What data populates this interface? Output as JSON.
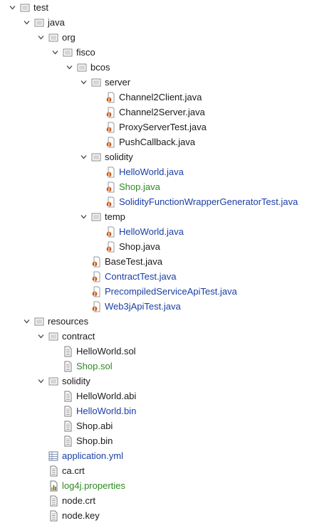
{
  "colors": {
    "default_text": "#1a1a1a",
    "modified_text": "#1a3ea5",
    "added_text": "#2c8a22",
    "folder_icon": "#8a8a8a",
    "java_icon": "#c85a1c"
  },
  "tree": {
    "test": {
      "label": "test",
      "expanded": true,
      "icon": "folder-icon"
    },
    "java": {
      "label": "java",
      "expanded": true,
      "icon": "folder-icon"
    },
    "org": {
      "label": "org",
      "expanded": true,
      "icon": "folder-icon"
    },
    "fisco": {
      "label": "fisco",
      "expanded": true,
      "icon": "folder-icon"
    },
    "bcos": {
      "label": "bcos",
      "expanded": true,
      "icon": "folder-icon"
    },
    "server": {
      "label": "server",
      "expanded": true,
      "icon": "folder-icon"
    },
    "server_files": [
      {
        "label": "Channel2Client.java",
        "status": "default",
        "icon": "java-file-icon"
      },
      {
        "label": "Channel2Server.java",
        "status": "default",
        "icon": "java-file-icon"
      },
      {
        "label": "ProxyServerTest.java",
        "status": "default",
        "icon": "java-file-icon"
      },
      {
        "label": "PushCallback.java",
        "status": "default",
        "icon": "java-file-icon"
      }
    ],
    "solidity": {
      "label": "solidity",
      "expanded": true,
      "icon": "folder-icon"
    },
    "solidity_files": [
      {
        "label": "HelloWorld.java",
        "status": "modified",
        "icon": "java-file-icon"
      },
      {
        "label": "Shop.java",
        "status": "added",
        "icon": "java-file-icon"
      },
      {
        "label": "SolidityFunctionWrapperGeneratorTest.java",
        "status": "modified",
        "icon": "java-file-icon"
      }
    ],
    "temp": {
      "label": "temp",
      "expanded": true,
      "icon": "folder-icon"
    },
    "temp_files": [
      {
        "label": "HelloWorld.java",
        "status": "modified",
        "icon": "java-file-icon"
      },
      {
        "label": "Shop.java",
        "status": "default",
        "icon": "java-file-icon"
      }
    ],
    "bcos_files": [
      {
        "label": "BaseTest.java",
        "status": "default",
        "icon": "java-file-icon"
      },
      {
        "label": "ContractTest.java",
        "status": "modified",
        "icon": "java-file-icon"
      },
      {
        "label": "PrecompiledServiceApiTest.java",
        "status": "modified",
        "icon": "java-file-icon"
      },
      {
        "label": "Web3jApiTest.java",
        "status": "modified",
        "icon": "java-file-icon"
      }
    ],
    "resources": {
      "label": "resources",
      "expanded": true,
      "icon": "folder-icon"
    },
    "contract": {
      "label": "contract",
      "expanded": true,
      "icon": "folder-icon"
    },
    "contract_files": [
      {
        "label": "HelloWorld.sol",
        "status": "default",
        "icon": "text-file-icon"
      },
      {
        "label": "Shop.sol",
        "status": "added",
        "icon": "text-file-icon"
      }
    ],
    "res_solidity": {
      "label": "solidity",
      "expanded": true,
      "icon": "folder-icon"
    },
    "res_solidity_files": [
      {
        "label": "HelloWorld.abi",
        "status": "default",
        "icon": "text-file-icon"
      },
      {
        "label": "HelloWorld.bin",
        "status": "modified",
        "icon": "text-file-icon"
      },
      {
        "label": "Shop.abi",
        "status": "default",
        "icon": "text-file-icon"
      },
      {
        "label": "Shop.bin",
        "status": "default",
        "icon": "text-file-icon"
      }
    ],
    "resources_files": [
      {
        "label": "application.yml",
        "status": "modified",
        "icon": "yml-file-icon"
      },
      {
        "label": "ca.crt",
        "status": "default",
        "icon": "text-file-icon"
      },
      {
        "label": "log4j.properties",
        "status": "added",
        "icon": "properties-file-icon"
      },
      {
        "label": "node.crt",
        "status": "default",
        "icon": "text-file-icon"
      },
      {
        "label": "node.key",
        "status": "default",
        "icon": "text-file-icon"
      }
    ]
  }
}
